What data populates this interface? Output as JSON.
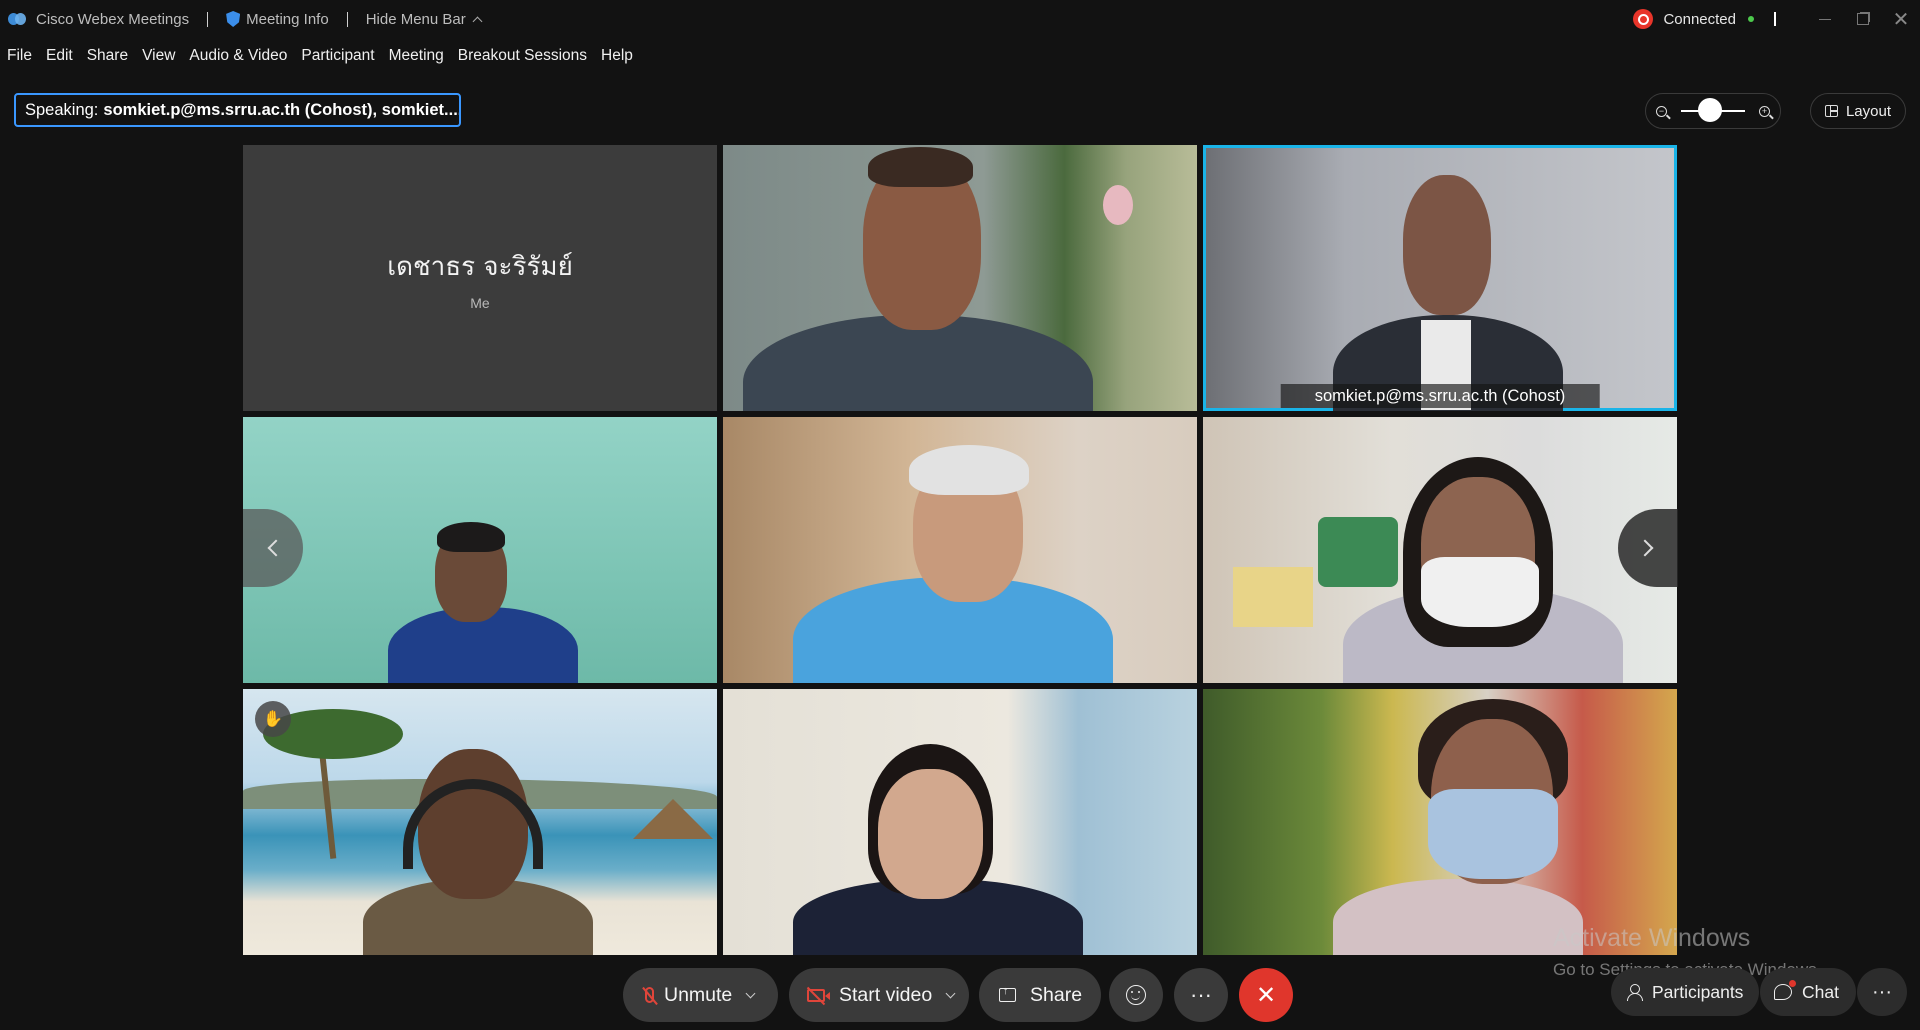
{
  "titlebar": {
    "app_name": "Cisco Webex Meetings",
    "meeting_info": "Meeting Info",
    "hide_menu_bar": "Hide Menu Bar",
    "status": "Connected"
  },
  "menu": [
    "File",
    "Edit",
    "Share",
    "View",
    "Audio & Video",
    "Participant",
    "Meeting",
    "Breakout Sessions",
    "Help"
  ],
  "speaking": {
    "label": "Speaking:",
    "names": "somkiet.p@ms.srru.ac.th (Cohost), somkiet...."
  },
  "zoom": {
    "level": 0.45
  },
  "layout_label": "Layout",
  "tiles": {
    "self": {
      "name": "เดชาธร จะริรัมย์",
      "sub": "Me"
    },
    "active_speaker_tag": "somkiet.p@ms.srru.ac.th  (Cohost)"
  },
  "controls": {
    "unmute": "Unmute",
    "start_video": "Start video",
    "share": "Share",
    "participants": "Participants",
    "chat": "Chat",
    "more": "···"
  },
  "watermark": {
    "title": "Activate Windows",
    "sub": "Go to Settings to activate Windows."
  },
  "colors": {
    "accent": "#1ab4e8",
    "end_call": "#e0362c",
    "muted": "#e0453a",
    "speaking_border": "#3a97ff"
  }
}
